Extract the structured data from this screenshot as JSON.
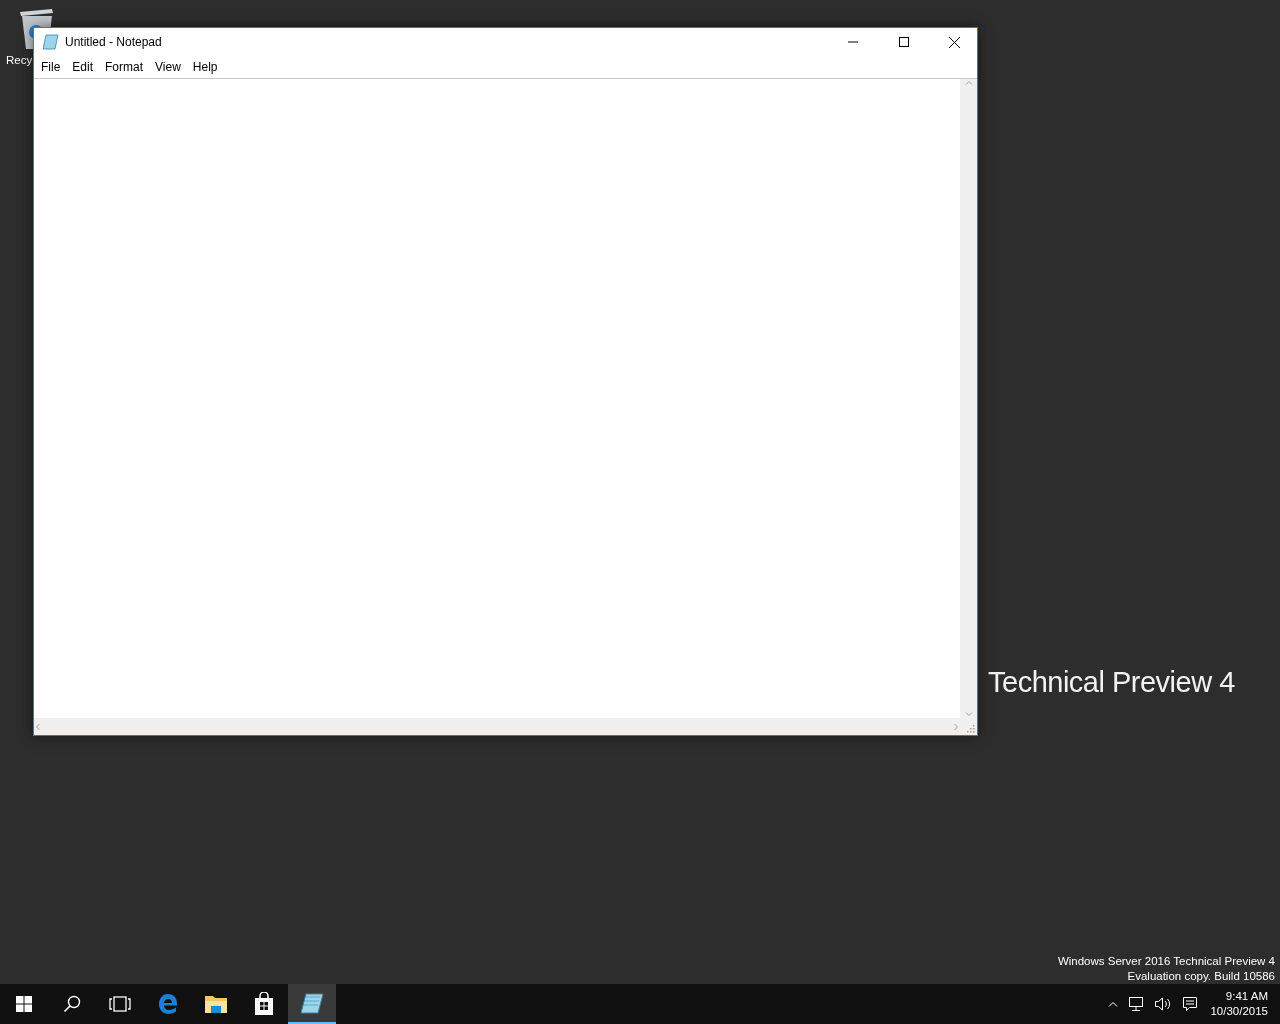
{
  "desktop": {
    "icons": [
      {
        "label": "Recy"
      }
    ],
    "wallpaper_text": "Technical Preview 4",
    "version_lines": [
      "Windows Server 2016 Technical Preview 4",
      "Evaluation copy. Build 10586"
    ]
  },
  "window": {
    "title": "Untitled - Notepad",
    "menu": [
      "File",
      "Edit",
      "Format",
      "View",
      "Help"
    ]
  },
  "taskbar": {
    "buttons": [
      {
        "kind": "start",
        "selected": false
      },
      {
        "kind": "search",
        "selected": false
      },
      {
        "kind": "taskview",
        "selected": false
      },
      {
        "kind": "edge",
        "selected": false
      },
      {
        "kind": "explorer",
        "selected": false
      },
      {
        "kind": "store",
        "selected": false
      },
      {
        "kind": "notepad",
        "selected": true
      }
    ],
    "clock": {
      "time": "9:41 AM",
      "date": "10/30/2015"
    }
  }
}
